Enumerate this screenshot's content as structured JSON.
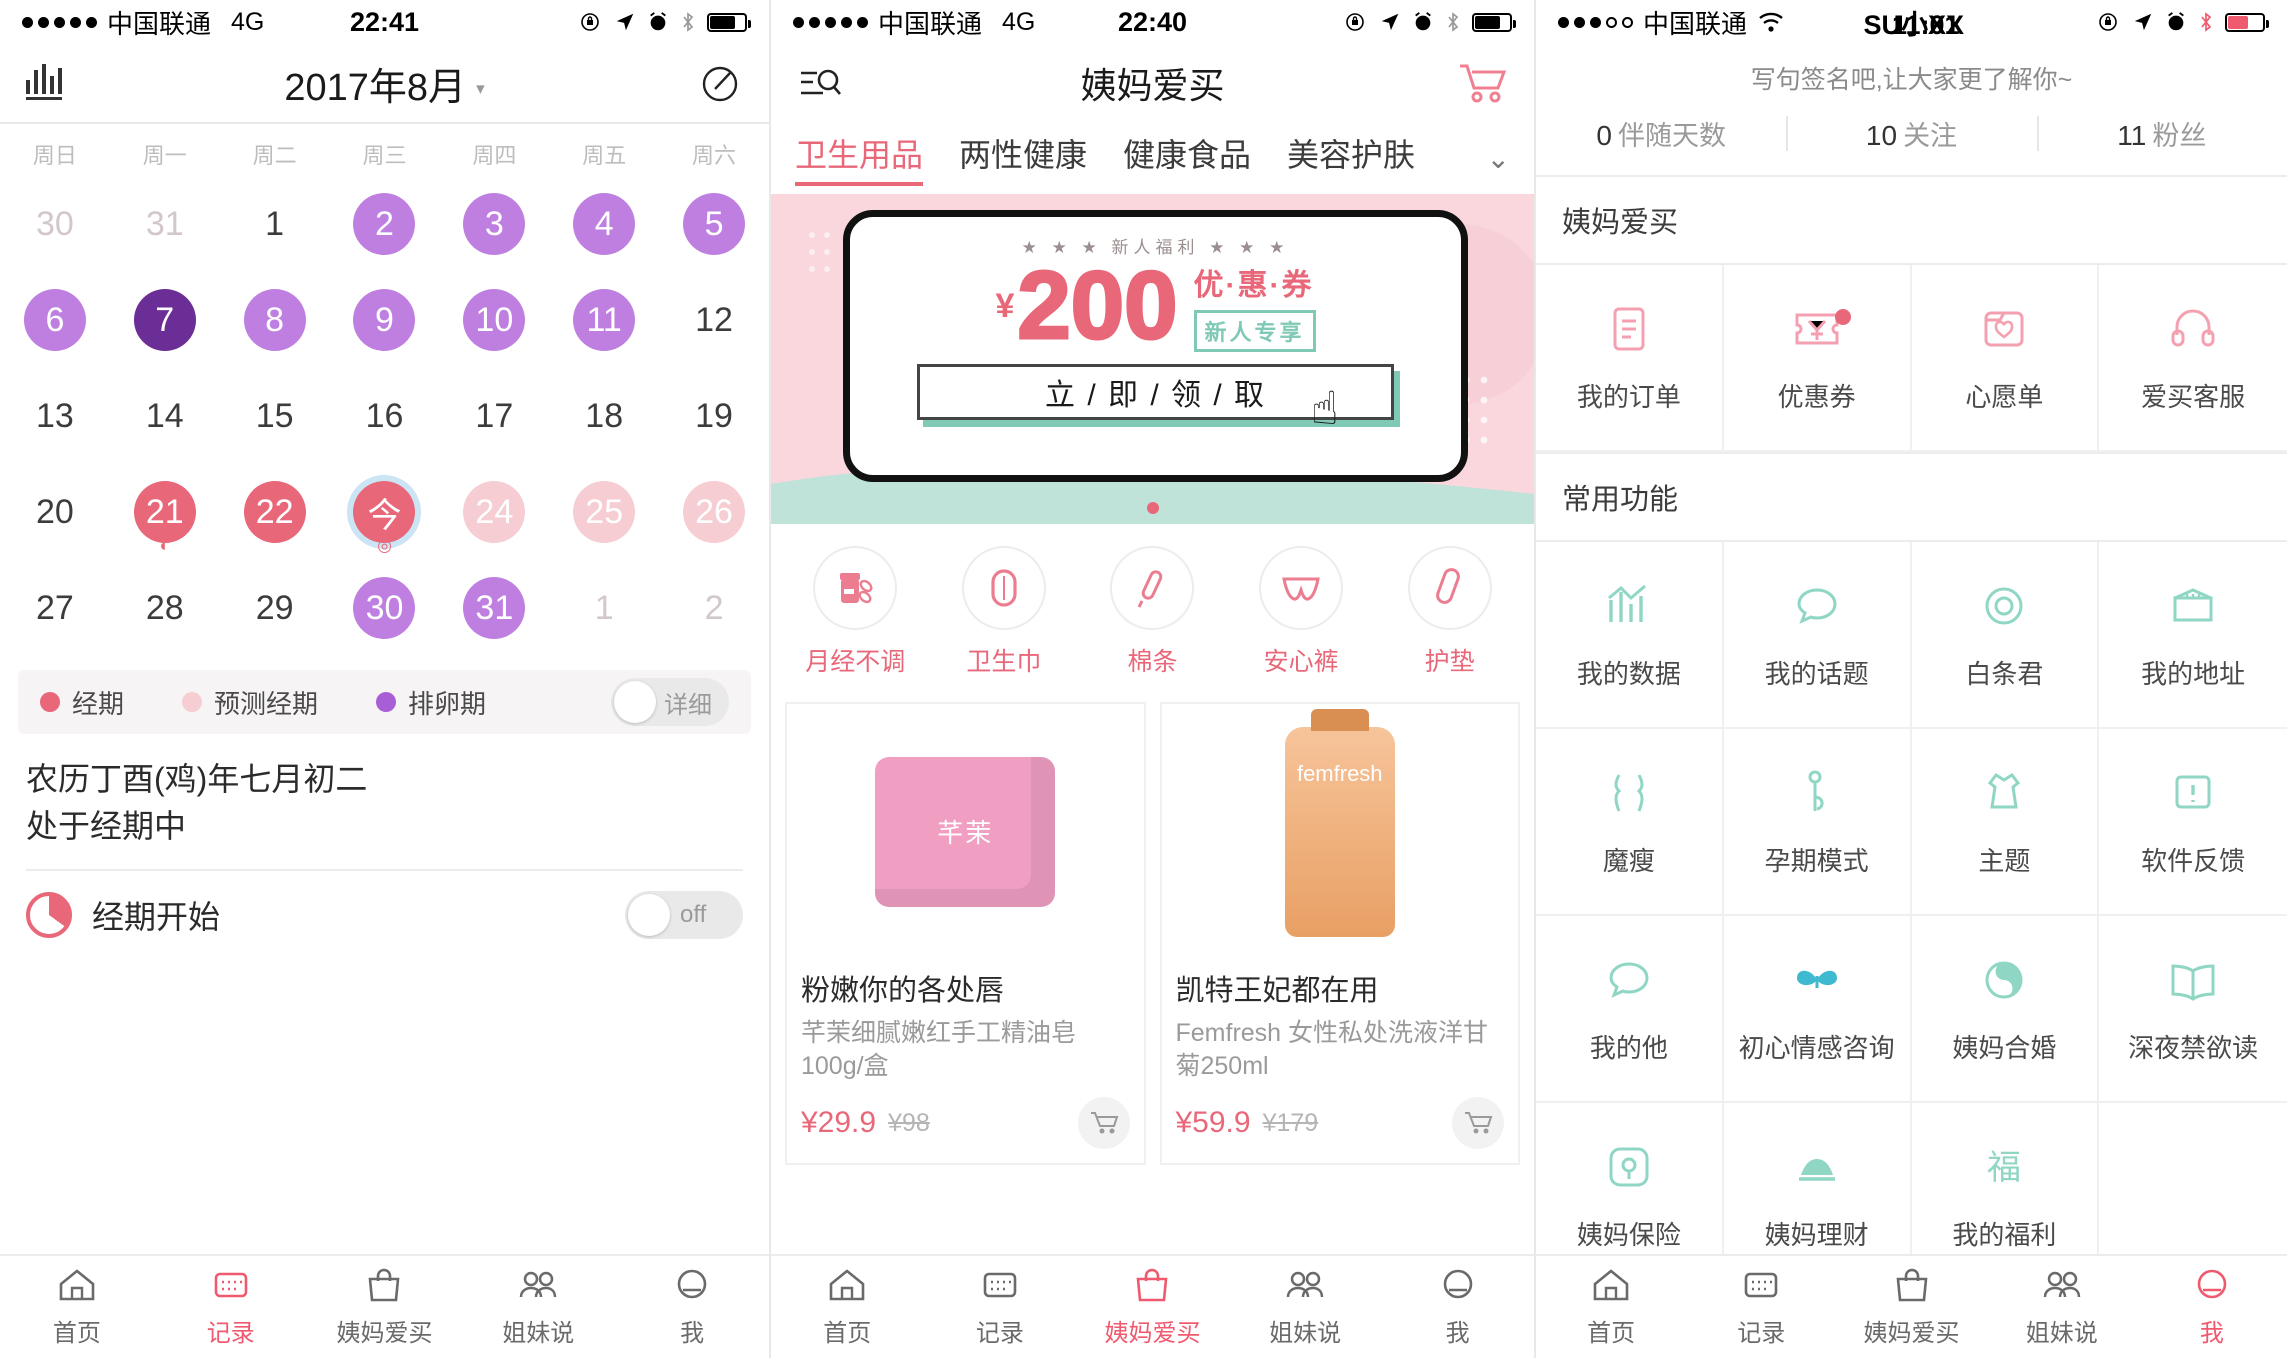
{
  "colors": {
    "accent": "#f05a6e",
    "period": "#e8687a",
    "predict": "#f6cdd3",
    "ovulation": "#bf7fe0",
    "ovulation_dark": "#6b2d96",
    "today_ring": "#cbe5f5",
    "mint": "#7fc9b6"
  },
  "screen1": {
    "status": {
      "carrier": "中国联通",
      "network": "4G",
      "time": "22:41"
    },
    "nav": {
      "title": "2017年8月",
      "caret": "▾",
      "chart_icon": "bar-chart-icon",
      "edit_icon": "edit-pen-icon"
    },
    "weekdays": [
      "周日",
      "周一",
      "周二",
      "周三",
      "周四",
      "周五",
      "周六"
    ],
    "days": [
      {
        "n": "30",
        "state": "muted"
      },
      {
        "n": "31",
        "state": "muted"
      },
      {
        "n": "1",
        "state": "normal"
      },
      {
        "n": "2",
        "state": "ovul"
      },
      {
        "n": "3",
        "state": "ovul"
      },
      {
        "n": "4",
        "state": "ovul"
      },
      {
        "n": "5",
        "state": "ovul"
      },
      {
        "n": "6",
        "state": "ovul"
      },
      {
        "n": "7",
        "state": "ovul-dark"
      },
      {
        "n": "8",
        "state": "ovul"
      },
      {
        "n": "9",
        "state": "ovul"
      },
      {
        "n": "10",
        "state": "ovul"
      },
      {
        "n": "11",
        "state": "ovul"
      },
      {
        "n": "12",
        "state": "normal"
      },
      {
        "n": "13",
        "state": "normal"
      },
      {
        "n": "14",
        "state": "normal"
      },
      {
        "n": "15",
        "state": "normal"
      },
      {
        "n": "16",
        "state": "normal"
      },
      {
        "n": "17",
        "state": "normal"
      },
      {
        "n": "18",
        "state": "normal"
      },
      {
        "n": "19",
        "state": "normal"
      },
      {
        "n": "20",
        "state": "normal"
      },
      {
        "n": "21",
        "state": "period",
        "mark": "◐"
      },
      {
        "n": "22",
        "state": "period"
      },
      {
        "n": "今",
        "state": "today",
        "mark": "◎"
      },
      {
        "n": "24",
        "state": "predict"
      },
      {
        "n": "25",
        "state": "predict"
      },
      {
        "n": "26",
        "state": "predict"
      },
      {
        "n": "27",
        "state": "normal"
      },
      {
        "n": "28",
        "state": "normal"
      },
      {
        "n": "29",
        "state": "normal"
      },
      {
        "n": "30",
        "state": "ovul"
      },
      {
        "n": "31",
        "state": "ovul"
      },
      {
        "n": "1",
        "state": "muted"
      },
      {
        "n": "2",
        "state": "muted"
      }
    ],
    "legend": [
      {
        "label": "经期",
        "color": "#e8687a"
      },
      {
        "label": "预测经期",
        "color": "#f6cdd3"
      },
      {
        "label": "排卵期",
        "color": "#a85fd6"
      }
    ],
    "detail_toggle_label": "详细",
    "lunar_line1": "农历丁酉(鸡)年七月初二",
    "lunar_line2": "处于经期中",
    "period_row": {
      "label": "经期开始",
      "switch_label": "off",
      "icon": "pie-chart-icon"
    }
  },
  "screen2": {
    "status": {
      "carrier": "中国联通",
      "network": "4G",
      "time": "22:40"
    },
    "nav": {
      "title": "姨妈爱买",
      "search_icon": "list-search-icon",
      "cart_icon": "shopping-cart-icon"
    },
    "tabs": [
      {
        "label": "卫生用品",
        "active": true
      },
      {
        "label": "两性健康",
        "active": false
      },
      {
        "label": "健康食品",
        "active": false
      },
      {
        "label": "美容护肤",
        "active": false
      }
    ],
    "tab_more_icon": "chevron-down-icon",
    "banner": {
      "new_user_text": "新人福利",
      "currency": "¥",
      "amount": "200",
      "coupon_text": "优·惠·券",
      "badge": "新人专享",
      "cta": "立 / 即 / 领 / 取",
      "cursor_icon": "hand-cursor-icon"
    },
    "categories": [
      {
        "label": "月经不调",
        "icon": "pill-bottle-icon"
      },
      {
        "label": "卫生巾",
        "icon": "sanitary-pad-icon"
      },
      {
        "label": "棉条",
        "icon": "tampon-icon"
      },
      {
        "label": "安心裤",
        "icon": "panty-icon"
      },
      {
        "label": "护垫",
        "icon": "panty-liner-icon"
      }
    ],
    "products": [
      {
        "title": "粉嫩你的各处唇",
        "desc": "芊茉细腻嫩红手工精油皂 100g/盒",
        "price": "¥29.9",
        "old_price": "¥98",
        "image": "pink-soap-image",
        "image_label": "芊茉"
      },
      {
        "title": "凯特王妃都在用",
        "desc": "Femfresh 女性私处洗液洋甘菊250ml",
        "price": "¥59.9",
        "old_price": "¥179",
        "image": "femfresh-bottle-image",
        "image_label": "femfresh"
      }
    ]
  },
  "screen3": {
    "status": {
      "carrier": "中国联通",
      "network": "wifi",
      "time": "11:01",
      "username": "SU小XX"
    },
    "signature": "写句签名吧,让大家更了解你~",
    "stats": [
      {
        "value": "0",
        "label": "伴随天数"
      },
      {
        "value": "10",
        "label": "关注"
      },
      {
        "value": "11",
        "label": "粉丝"
      }
    ],
    "section1_title": "姨妈爱买",
    "shop_items": [
      {
        "label": "我的订单",
        "icon": "order-list-icon",
        "badge": false
      },
      {
        "label": "优惠券",
        "icon": "coupon-icon",
        "badge": true
      },
      {
        "label": "心愿单",
        "icon": "wishlist-heart-icon",
        "badge": false
      },
      {
        "label": "爱买客服",
        "icon": "headset-support-icon",
        "badge": false
      }
    ],
    "section2_title": "常用功能",
    "fn_items": [
      {
        "label": "我的数据",
        "icon": "chart-trend-icon"
      },
      {
        "label": "我的话题",
        "icon": "speech-bubble-icon"
      },
      {
        "label": "白条君",
        "icon": "circle-ring-icon"
      },
      {
        "label": "我的地址",
        "icon": "address-book-icon"
      },
      {
        "label": "魔瘦",
        "icon": "slim-waist-icon"
      },
      {
        "label": "孕期模式",
        "icon": "pregnancy-icon"
      },
      {
        "label": "主题",
        "icon": "dress-theme-icon"
      },
      {
        "label": "软件反馈",
        "icon": "feedback-exclaim-icon"
      },
      {
        "label": "我的他",
        "icon": "chat-bubble-icon"
      },
      {
        "label": "初心情感咨询",
        "icon": "butterfly-icon"
      },
      {
        "label": "姨妈合婚",
        "icon": "yinyang-icon"
      },
      {
        "label": "深夜禁欲读",
        "icon": "open-book-icon"
      },
      {
        "label": "姨妈保险",
        "icon": "shield-insurance-icon"
      },
      {
        "label": "姨妈理财",
        "icon": "ingot-finance-icon"
      },
      {
        "label": "我的福利",
        "icon": "fu-blessing-icon"
      }
    ]
  },
  "tabbar": {
    "items": [
      {
        "label": "首页",
        "icon": "home-icon"
      },
      {
        "label": "记录",
        "icon": "record-icon"
      },
      {
        "label": "姨妈爱买",
        "icon": "bag-icon"
      },
      {
        "label": "姐妹说",
        "icon": "people-icon"
      },
      {
        "label": "我",
        "icon": "person-icon"
      }
    ],
    "active1": 1,
    "active2": 2,
    "active3": 4
  }
}
